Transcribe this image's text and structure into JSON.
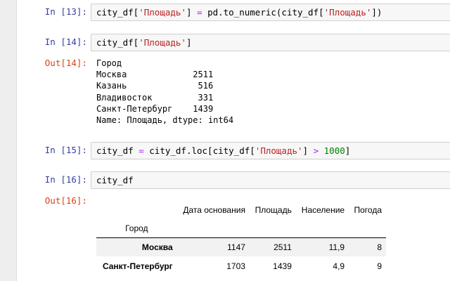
{
  "cells": [
    {
      "prompt": "In [13]:",
      "code": [
        {
          "t": "city_df[",
          "c": "plain"
        },
        {
          "t": "'Площадь'",
          "c": "str"
        },
        {
          "t": "] ",
          "c": "plain"
        },
        {
          "t": "=",
          "c": "op"
        },
        {
          "t": " pd.to_numeric(city_df[",
          "c": "plain"
        },
        {
          "t": "'Площадь'",
          "c": "str"
        },
        {
          "t": "])",
          "c": "plain"
        }
      ]
    },
    {
      "prompt": "In [14]:",
      "code": [
        {
          "t": "city_df[",
          "c": "plain"
        },
        {
          "t": "'Площадь'",
          "c": "str"
        },
        {
          "t": "]",
          "c": "plain"
        }
      ],
      "out_prompt": "Out[14]:",
      "output": "Город\nМосква             2511\nКазань              516\nВладивосток         331\nСанкт-Петербург    1439\nName: Площадь, dtype: int64"
    },
    {
      "prompt": "In [15]:",
      "code": [
        {
          "t": "city_df ",
          "c": "plain"
        },
        {
          "t": "=",
          "c": "op"
        },
        {
          "t": " city_df.loc[city_df[",
          "c": "plain"
        },
        {
          "t": "'Площадь'",
          "c": "str"
        },
        {
          "t": "] ",
          "c": "plain"
        },
        {
          "t": ">",
          "c": "op"
        },
        {
          "t": " ",
          "c": "plain"
        },
        {
          "t": "1000",
          "c": "num"
        },
        {
          "t": "]",
          "c": "plain"
        }
      ]
    },
    {
      "prompt": "In [16]:",
      "code": [
        {
          "t": "city_df",
          "c": "plain"
        }
      ],
      "out_prompt": "Out[16]:",
      "table": {
        "columns": [
          "Дата основания",
          "Площадь",
          "Население",
          "Погода"
        ],
        "index_name": "Город",
        "rows": [
          {
            "index": "Москва",
            "values": [
              "1147",
              "2511",
              "11,9",
              "8"
            ]
          },
          {
            "index": "Санкт-Петербург",
            "values": [
              "1703",
              "1439",
              "4,9",
              "9"
            ]
          }
        ]
      }
    }
  ]
}
